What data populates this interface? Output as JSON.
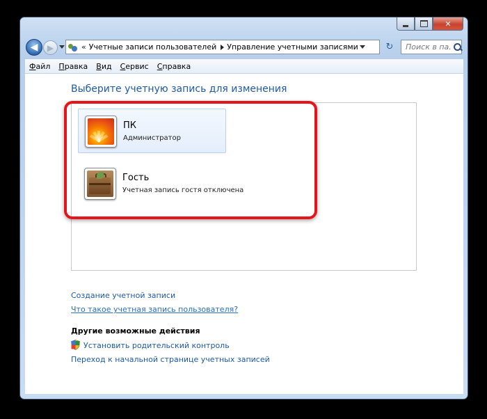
{
  "window": {
    "caption": {
      "minimize_glyph": "–",
      "maximize_glyph": "□",
      "close_glyph": "✕"
    }
  },
  "nav": {
    "back_glyph": "◀",
    "forward_glyph": "▶",
    "address": {
      "overflow_chevron": "«",
      "crumbs": [
        "Учетные записи пользователей",
        "Управление учетными записями"
      ]
    },
    "refresh_glyph": "↻",
    "search_placeholder": "Поиск в па..."
  },
  "menubar": {
    "items": [
      {
        "accel": "Ф",
        "rest": "айл"
      },
      {
        "accel": "П",
        "rest": "равка"
      },
      {
        "accel": "В",
        "rest": "ид"
      },
      {
        "accel": "С",
        "rest": "ервис"
      },
      {
        "accel": "С",
        "rest": "правка"
      }
    ]
  },
  "content": {
    "title": "Выберите учетную запись для изменения",
    "accounts": [
      {
        "name": "ПК",
        "role": "Администратор",
        "picture": "orange-flower-avatar"
      },
      {
        "name": "Гость",
        "role": "Учетная запись гостя отключена",
        "picture": "briefcase-avatar"
      }
    ],
    "links": {
      "create_account": "Создание учетной записи",
      "what_is_account": "Что такое учетная запись пользователя?"
    },
    "other_actions": {
      "heading": "Другие возможные действия",
      "parental_control": "Установить родительский контроль",
      "goto_main": "Переход к начальной странице учетных записей"
    }
  },
  "colors": {
    "accent_link": "#1e5aa8",
    "highlight_frame": "#e4161b"
  }
}
